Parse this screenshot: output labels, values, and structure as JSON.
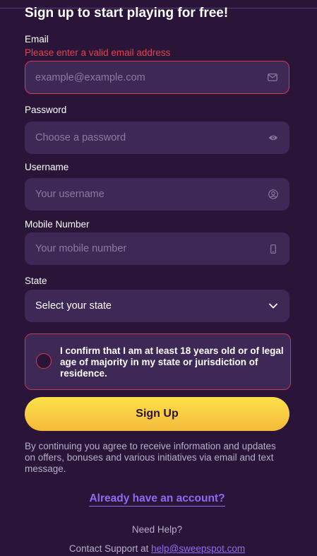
{
  "heading": "Sign up to start playing for free!",
  "email": {
    "label": "Email",
    "error": "Please enter a valid email address",
    "placeholder": "example@example.com",
    "icon": "envelope-icon"
  },
  "password": {
    "label": "Password",
    "placeholder": "Choose a password",
    "icon": "eye-icon"
  },
  "username": {
    "label": "Username",
    "placeholder": "Your username",
    "icon": "user-circle-icon"
  },
  "mobile": {
    "label": "Mobile Number",
    "placeholder": "Your mobile number",
    "icon": "phone-icon"
  },
  "state": {
    "label": "State",
    "value": "Select your state",
    "icon": "chevron-down-icon"
  },
  "age_confirm": {
    "text": "I confirm that I am at least 18 years old or of legal age of majority in my state or jurisdiction of residence.",
    "checked": false
  },
  "signup_button": "Sign Up",
  "disclaimer": "By continuing you agree to receive information and updates on offers, bonuses and various initiatives via email and text message.",
  "login_link": "Already have an account?",
  "help": {
    "title": "Need Help?",
    "contact_prefix": "Contact Support at",
    "email": "help@sweepspot.com"
  },
  "colors": {
    "background": "#2a1538",
    "field": "#3d2856",
    "error": "#d63a56",
    "accent": "#8e6bf2",
    "button": "#fbd444"
  }
}
